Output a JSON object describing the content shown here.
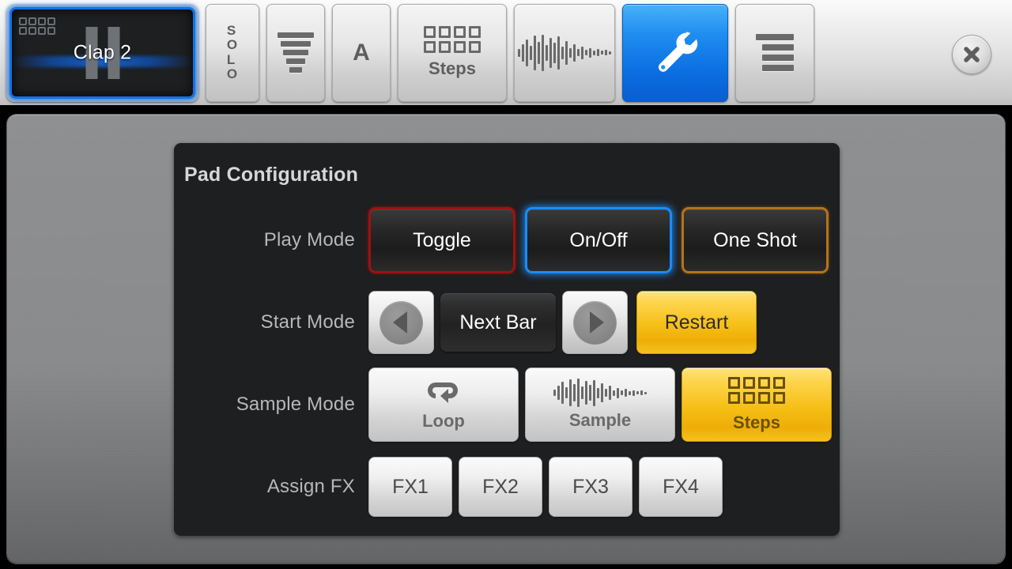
{
  "toolbar": {
    "pad": {
      "name": "Clap 2",
      "steps_icon": "steps-grid-icon",
      "pause_icon": "pause-icon",
      "selected": true,
      "border_color": "#1273e6"
    },
    "buttons": [
      {
        "id": "solo",
        "label": "SOLO",
        "letters": [
          "S",
          "O",
          "L",
          "O"
        ],
        "icon": "",
        "active": false
      },
      {
        "id": "filter",
        "label": "",
        "icon": "filter-icon",
        "active": false
      },
      {
        "id": "pitch",
        "label": "A",
        "icon": "letter-a-icon",
        "active": false
      },
      {
        "id": "steps",
        "label": "Steps",
        "icon": "steps-grid-icon",
        "active": false
      },
      {
        "id": "sample",
        "label": "",
        "icon": "waveform-icon",
        "active": false
      },
      {
        "id": "config",
        "label": "",
        "icon": "wrench-icon",
        "active": true
      },
      {
        "id": "menu",
        "label": "",
        "icon": "list-menu-icon",
        "active": false
      }
    ],
    "close_label": "×",
    "active_color": "#1f8ef1"
  },
  "config": {
    "title": "Pad Configuration",
    "rows": {
      "play_mode": {
        "label": "Play Mode",
        "options": [
          {
            "label": "Toggle",
            "state": "unselected",
            "border": "#9d1111"
          },
          {
            "label": "On/Off",
            "state": "selected",
            "border": "#1a8cff"
          },
          {
            "label": "One Shot",
            "state": "unselected",
            "border": "#b5731a"
          }
        ]
      },
      "start_mode": {
        "label": "Start Mode",
        "prev_icon": "arrow-left-icon",
        "next_icon": "arrow-right-icon",
        "value": "Next Bar",
        "restart_label": "Restart"
      },
      "sample_mode": {
        "label": "Sample Mode",
        "options": [
          {
            "label": "Loop",
            "icon": "loop-icon",
            "selected": false
          },
          {
            "label": "Sample",
            "icon": "waveform-icon",
            "selected": false
          },
          {
            "label": "Steps",
            "icon": "steps-grid-icon",
            "selected": true
          }
        ]
      },
      "assign_fx": {
        "label": "Assign FX",
        "options": [
          "FX1",
          "FX2",
          "FX3",
          "FX4"
        ]
      }
    },
    "accent_gold": "#f6bf16"
  }
}
